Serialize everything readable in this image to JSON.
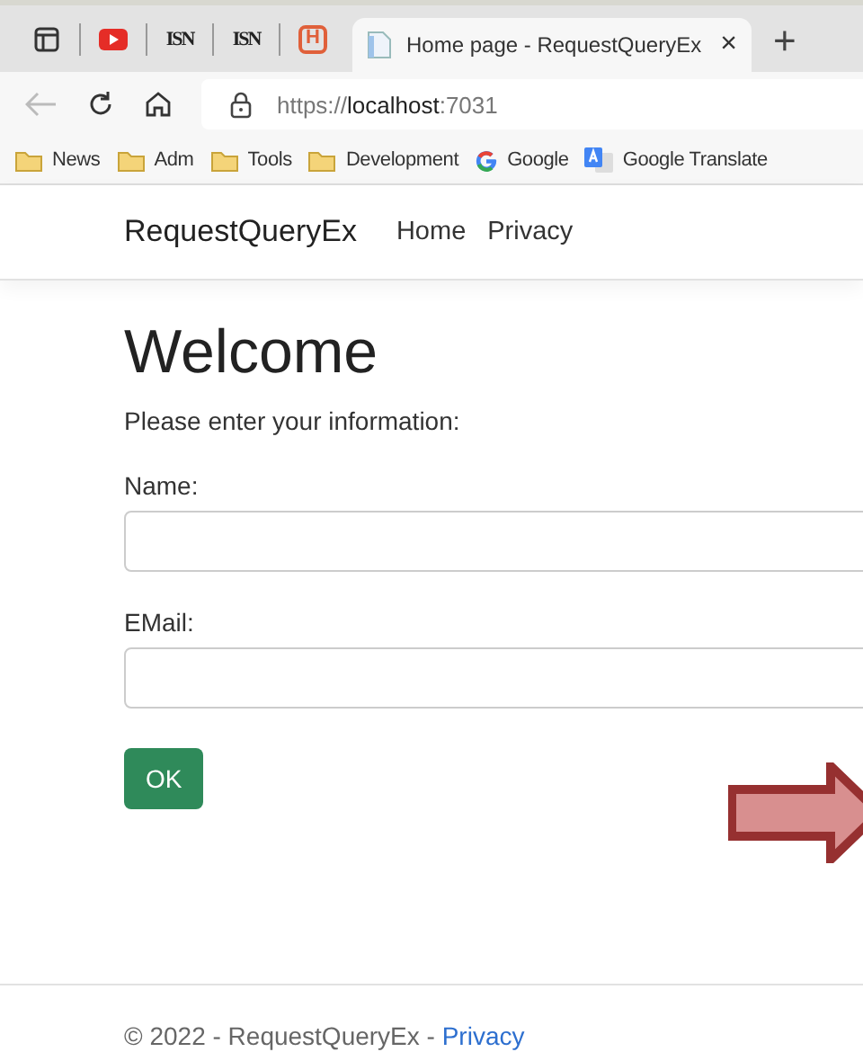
{
  "browser": {
    "pinned_tabs": [
      {
        "kind": "sidebar"
      },
      {
        "kind": "youtube"
      },
      {
        "kind": "logo",
        "label": "ISN"
      },
      {
        "kind": "logo",
        "label": "ISN"
      },
      {
        "kind": "badge",
        "label": "H"
      }
    ],
    "active_tab": {
      "title": "Home page - RequestQueryEx",
      "close": "×"
    },
    "new_tab": "+",
    "address": {
      "scheme": "https://",
      "host": "localhost",
      "port": ":7031"
    },
    "bookmarks": [
      {
        "kind": "folder",
        "label": "News"
      },
      {
        "kind": "folder",
        "label": "Adm"
      },
      {
        "kind": "folder",
        "label": "Tools"
      },
      {
        "kind": "folder",
        "label": "Development"
      },
      {
        "kind": "google",
        "label": "Google"
      },
      {
        "kind": "translate",
        "label": "Google Translate"
      }
    ]
  },
  "navbar": {
    "brand": "RequestQueryEx",
    "links": [
      "Home",
      "Privacy"
    ]
  },
  "content": {
    "heading": "Welcome",
    "intro": "Please enter your information:",
    "fields": [
      {
        "label": "Name:"
      },
      {
        "label": "EMail:"
      }
    ],
    "button": "OK"
  },
  "footer": {
    "text": "© 2022 - RequestQueryEx - ",
    "link": "Privacy"
  }
}
